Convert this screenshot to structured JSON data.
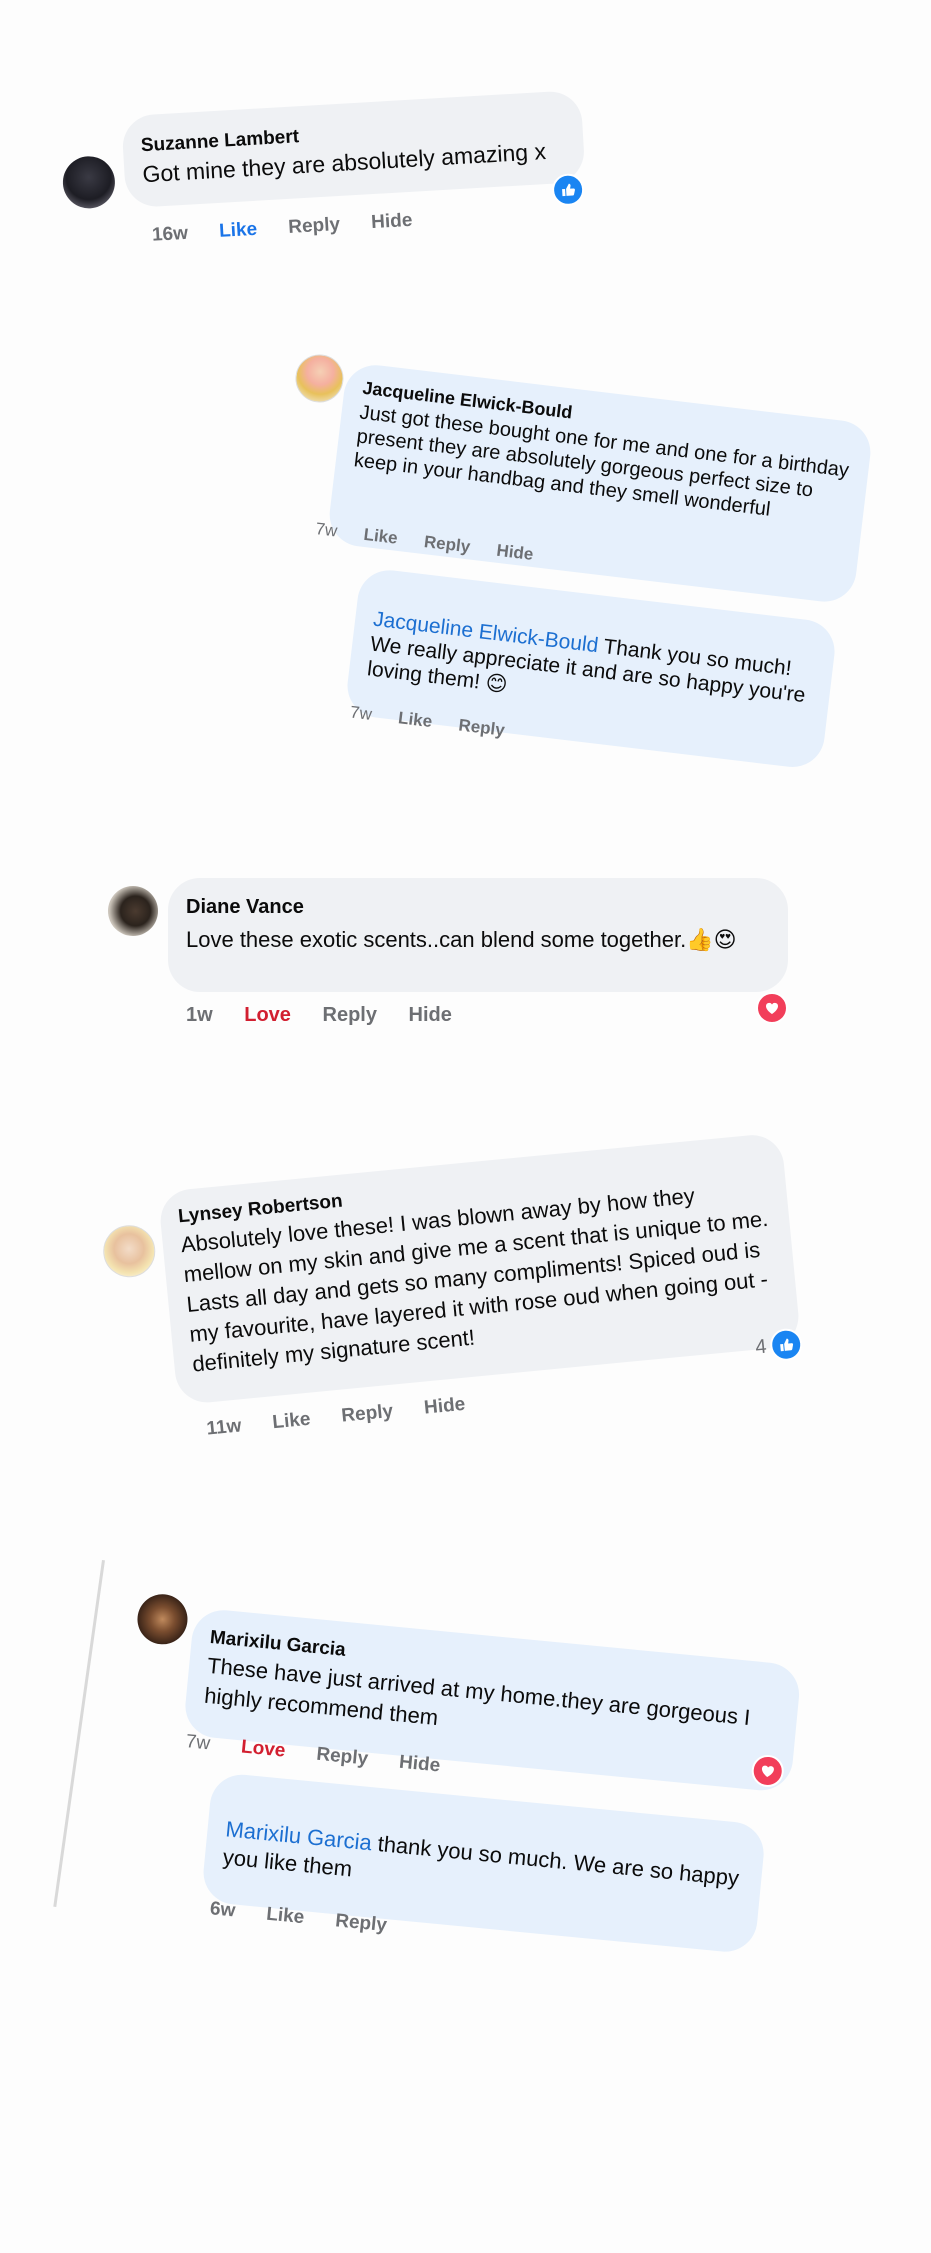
{
  "comments": [
    {
      "author": "Suzanne Lambert",
      "text": "Got mine they are absolutely amazing x",
      "time": "16w",
      "like": "Like",
      "reply": "Reply",
      "hide": "Hide",
      "reaction": "like"
    },
    {
      "author": "Jacqueline Elwick-Bould",
      "text": "Just got these bought one for me and one for a birthday present they are absolutely gorgeous perfect size to keep in your handbag and they smell wonderful",
      "time": "7w",
      "like": "Like",
      "reply": "Reply",
      "hide": "Hide",
      "reply_item": {
        "mention": "Jacqueline Elwick-Bould",
        "text": "Thank you so much! We really appreciate it and are so happy you're loving them! 😊",
        "time": "7w",
        "like": "Like",
        "reply": "Reply"
      }
    },
    {
      "author": "Diane Vance",
      "text": "Love these exotic scents..can blend some together.👍😍",
      "time": "1w",
      "love": "Love",
      "reply": "Reply",
      "hide": "Hide",
      "reaction": "love"
    },
    {
      "author": "Lynsey Robertson",
      "text": "Absolutely love these! I was blown away by how they mellow on my skin and give me a scent that is unique to me. Lasts all day and gets so many compliments! Spiced oud is my favourite, have layered it with rose oud when going out - definitely my signature scent!",
      "time": "11w",
      "like": "Like",
      "reply": "Reply",
      "hide": "Hide",
      "reaction": "like",
      "reaction_count": "4"
    },
    {
      "author": "Marixilu Garcia",
      "text": "These have just arrived at my home.they are gorgeous I highly recommend them",
      "time": "7w",
      "love": "Love",
      "reply": "Reply",
      "hide": "Hide",
      "reaction": "love",
      "reply_item": {
        "mention": "Marixilu Garcia",
        "text": "thank you so much. We are so happy you like them",
        "time": "6w",
        "like": "Like",
        "reply": "Reply"
      }
    }
  ],
  "colors": {
    "bubble_grey": "#eff1f4",
    "bubble_blue": "#e6f0fc",
    "like_blue": "#1a74e8",
    "love_red": "#d21f30",
    "mention_blue": "#1c6fd1"
  }
}
